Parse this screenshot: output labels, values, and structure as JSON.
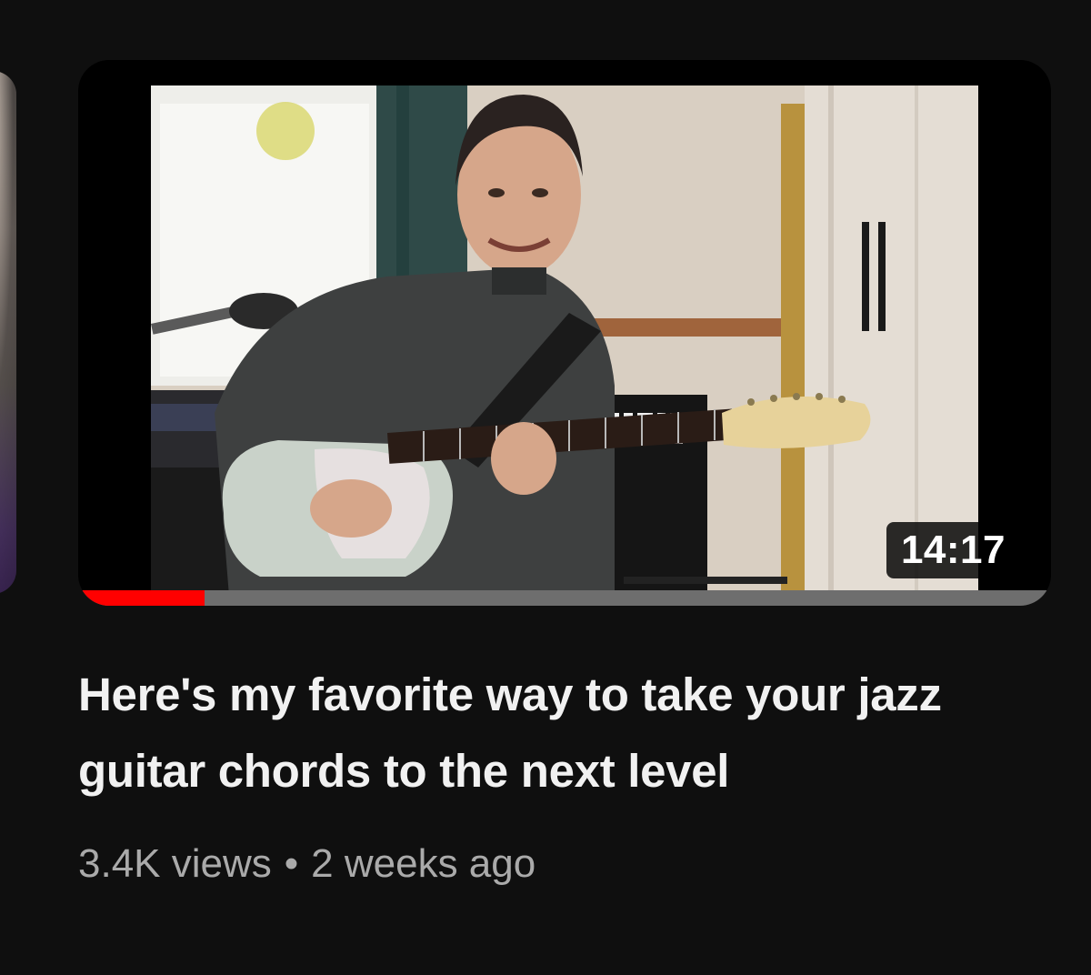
{
  "video": {
    "duration": "14:17",
    "watch_progress": 0.13,
    "title": "Here's my favorite way to take your jazz guitar chords to the next level",
    "views": "3.4K views",
    "separator": "•",
    "age": "2 weeks ago",
    "thumbnail_description": "man playing electric guitar"
  },
  "colors": {
    "background": "#0f0f0f",
    "progress": "#ff0000",
    "progress_track": "#6e6e6e",
    "title_text": "#f1f1f1",
    "meta_text": "#aaaaaa"
  }
}
